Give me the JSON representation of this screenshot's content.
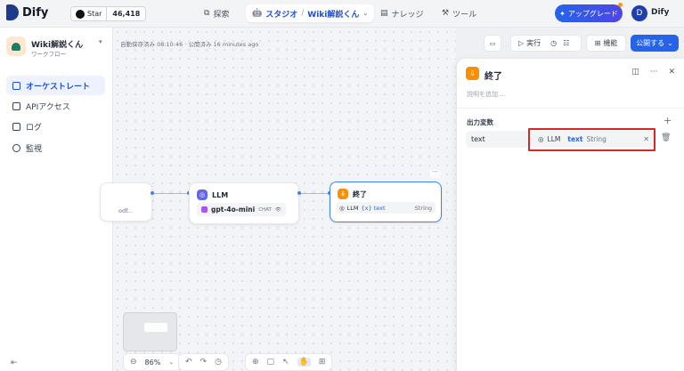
{
  "header": {
    "logo": "Dify",
    "github": {
      "label": "Star",
      "count": "46,418"
    },
    "nav": [
      {
        "label": "探索"
      },
      {
        "label": "スタジオ",
        "sub": "Wiki解説くん"
      },
      {
        "label": "ナレッジ"
      },
      {
        "label": "ツール"
      }
    ],
    "nav_separator": "/",
    "upgrade_label": "アップグレード",
    "user_initial": "D",
    "user_name": "Dify"
  },
  "sidebar": {
    "app_name": "Wiki解説くん",
    "app_type": "ワークフロー",
    "items": [
      {
        "label": "オーケストレート",
        "active": true
      },
      {
        "label": "APIアクセス"
      },
      {
        "label": "ログ"
      },
      {
        "label": "監視"
      }
    ]
  },
  "toolbar": {
    "status": "自動保存済み 08:10:46 · 公開済み 16 minutes ago",
    "run_label": "実行",
    "features_label": "機能",
    "publish_label": "公開する"
  },
  "nodes": {
    "prev_snippet": "odf...",
    "llm": {
      "title": "LLM",
      "model": "gpt-4o-mini",
      "tag": "CHAT"
    },
    "end": {
      "title": "終了",
      "var_source": "LLM",
      "var_name": "{x} text",
      "var_type": "String"
    }
  },
  "controls": {
    "zoom": "86%"
  },
  "panel": {
    "title": "終了",
    "description_placeholder": "説明を追加...",
    "output_label": "出力変数",
    "variable": {
      "name": "text",
      "source": "LLM",
      "value": "text",
      "type": "String"
    }
  },
  "colors": {
    "accent": "#2563eb",
    "end_node": "#f79009",
    "highlight": "#dc2626"
  }
}
